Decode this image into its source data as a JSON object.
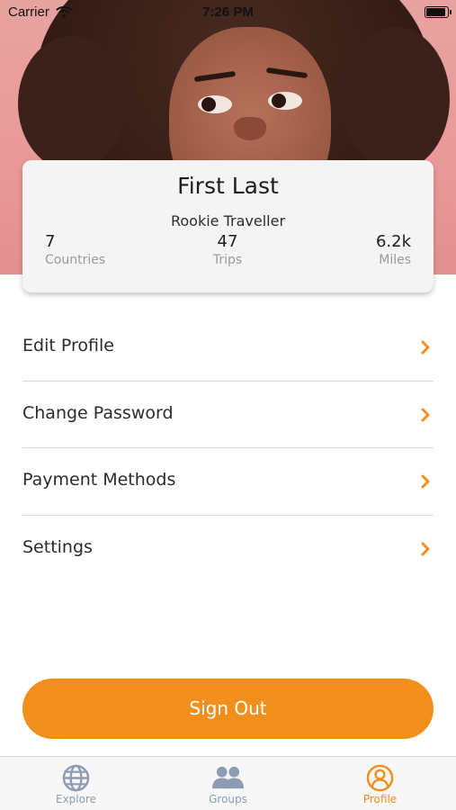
{
  "status_bar": {
    "carrier": "Carrier",
    "time": "7:26 PM"
  },
  "profile": {
    "name": "First Last",
    "rank": "Rookie Traveller",
    "stats": [
      {
        "value": "7",
        "label": "Countries"
      },
      {
        "value": "47",
        "label": "Trips"
      },
      {
        "value": "6.2k",
        "label": "Miles"
      }
    ]
  },
  "menu": {
    "items": [
      {
        "label": "Edit Profile",
        "icon": "chevron-right-icon"
      },
      {
        "label": "Change Password",
        "icon": "chevron-right-icon"
      },
      {
        "label": "Payment Methods",
        "icon": "chevron-right-icon"
      },
      {
        "label": "Settings",
        "icon": "chevron-right-icon"
      }
    ]
  },
  "sign_out": {
    "label": "Sign Out"
  },
  "tab_bar": {
    "tabs": [
      {
        "label": "Explore",
        "icon": "globe-icon",
        "active": false
      },
      {
        "label": "Groups",
        "icon": "users-icon",
        "active": false
      },
      {
        "label": "Profile",
        "icon": "user-circle-icon",
        "active": true
      }
    ]
  },
  "colors": {
    "accent": "#f18e1c",
    "tab_inactive": "#8f9bb3",
    "tab_active": "#f18e1c",
    "hero_background": "#e99a98"
  }
}
